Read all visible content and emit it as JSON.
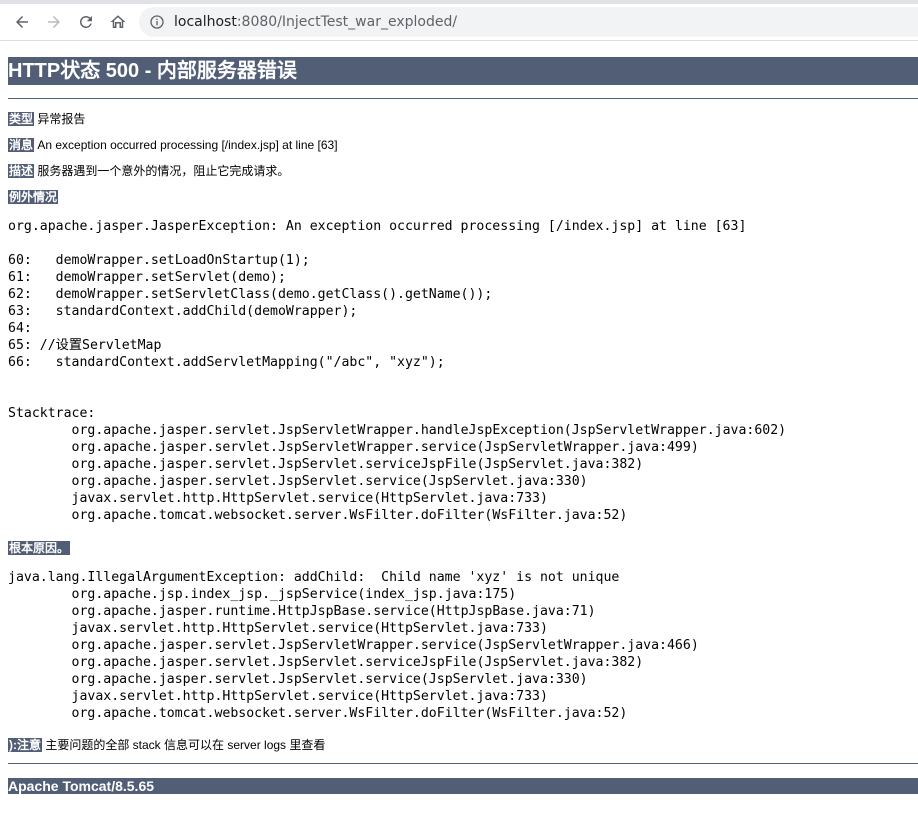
{
  "browser": {
    "url_host": "localhost",
    "url_rest": ":8080/InjectTest_war_exploded/",
    "icons": [
      "back-arrow-icon",
      "forward-arrow-icon",
      "reload-icon",
      "home-icon",
      "info-icon"
    ]
  },
  "page": {
    "title": "HTTP状态 500 - 内部服务器错误",
    "type_label": "类型",
    "type_value": "异常报告",
    "message_label": "消息",
    "message_value": "An exception occurred processing [/index.jsp] at line [63]",
    "description_label": "描述",
    "description_value": "服务器遇到一个意外的情况，阻止它完成请求。",
    "exception_label": "例外情况",
    "exception_text": "org.apache.jasper.JasperException: An exception occurred processing [/index.jsp] at line [63]\n\n60:   demoWrapper.setLoadOnStartup(1);\n61:   demoWrapper.setServlet(demo);\n62:   demoWrapper.setServletClass(demo.getClass().getName());\n63:   standardContext.addChild(demoWrapper);\n64:\n65: //设置ServletMap\n66:   standardContext.addServletMapping(\"/abc\", \"xyz\");\n\n\nStacktrace:\n\torg.apache.jasper.servlet.JspServletWrapper.handleJspException(JspServletWrapper.java:602)\n\torg.apache.jasper.servlet.JspServletWrapper.service(JspServletWrapper.java:499)\n\torg.apache.jasper.servlet.JspServlet.serviceJspFile(JspServlet.java:382)\n\torg.apache.jasper.servlet.JspServlet.service(JspServlet.java:330)\n\tjavax.servlet.http.HttpServlet.service(HttpServlet.java:733)\n\torg.apache.tomcat.websocket.server.WsFilter.doFilter(WsFilter.java:52)",
    "root_cause_label": "根本原因。",
    "root_cause_text": "java.lang.IllegalArgumentException: addChild:  Child name 'xyz' is not unique\n\torg.apache.jsp.index_jsp._jspService(index_jsp.java:175)\n\torg.apache.jasper.runtime.HttpJspBase.service(HttpJspBase.java:71)\n\tjavax.servlet.http.HttpServlet.service(HttpServlet.java:733)\n\torg.apache.jasper.servlet.JspServletWrapper.service(JspServletWrapper.java:466)\n\torg.apache.jasper.servlet.JspServlet.serviceJspFile(JspServlet.java:382)\n\torg.apache.jasper.servlet.JspServlet.service(JspServlet.java:330)\n\tjavax.servlet.http.HttpServlet.service(HttpServlet.java:733)\n\torg.apache.tomcat.websocket.server.WsFilter.doFilter(WsFilter.java:52)",
    "note_label": "):注意",
    "note_value": "主要问题的全部 stack 信息可以在 server logs 里查看",
    "footer": "Apache Tomcat/8.5.65"
  },
  "colors": {
    "banner": "#525d76",
    "chrome_bg": "#dfe1e5",
    "omnibox_bg": "#f1f3f4"
  }
}
